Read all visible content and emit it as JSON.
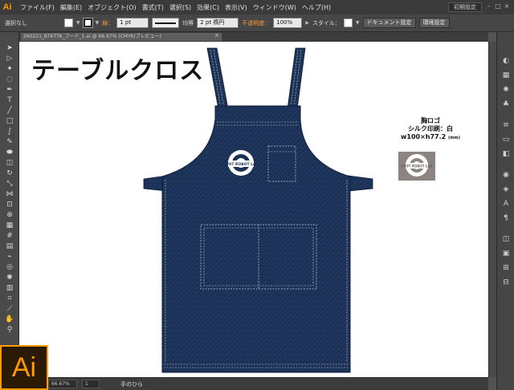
{
  "app": {
    "logo": "Ai",
    "menu": [
      "ファイル(F)",
      "編集(E)",
      "オブジェクト(O)",
      "書式(T)",
      "選択(S)",
      "効果(C)",
      "表示(V)",
      "ウィンドウ(W)",
      "ヘルプ(H)"
    ],
    "workspace": "初期設定",
    "window_controls": [
      "–",
      "□",
      "×"
    ]
  },
  "control_bar": {
    "selection": "選択なし",
    "stroke_label": "線：",
    "stroke_weight": "1 pt",
    "line_style": "均等",
    "brush": "2 pt 楕円",
    "opacity_label": "不透明度：",
    "opacity_value": "100%",
    "style_label": "スタイル：",
    "doc_settings": "ドキュメント設定",
    "prefs": "環境設定"
  },
  "document_tab": {
    "title": "260221_BT6TTK_フード_1.ai @ 66.67% (CMYK/プレビュー)",
    "close": "×"
  },
  "artboard": {
    "title": "テーブルクロス",
    "logo_caption": [
      "胸ロゴ",
      "シルク印刷：白"
    ],
    "logo_size": "w100×h77.2",
    "logo_size_unit": "(mm)",
    "logo_text": "EVOT ROBOT LAB"
  },
  "status": {
    "zoom": "66.67%",
    "page": "1",
    "tool": "手のひら"
  },
  "colors": {
    "apron": "#1c3156",
    "stitch": "#c7ced8",
    "accent": "#ff9a00"
  },
  "icons": {
    "badge": "Ai"
  }
}
